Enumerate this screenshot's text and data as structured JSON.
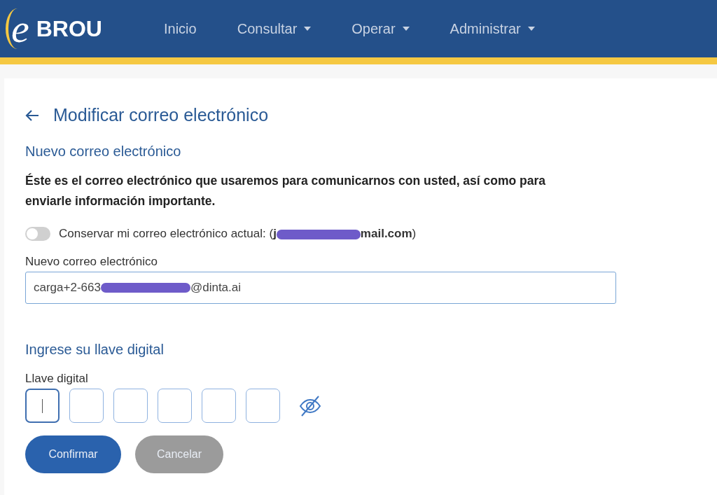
{
  "header": {
    "logo_letter": "e",
    "logo_text": "BROU",
    "nav": [
      {
        "label": "Inicio",
        "dropdown": false
      },
      {
        "label": "Consultar",
        "dropdown": true
      },
      {
        "label": "Operar",
        "dropdown": true
      },
      {
        "label": "Administrar",
        "dropdown": true
      }
    ]
  },
  "page": {
    "title": "Modificar correo electrónico",
    "section": "Nuevo correo electrónico",
    "description": "Éste es el correo electrónico que usaremos para comunicarnos con usted, así como para enviarle información importante.",
    "keep_toggle": {
      "checked": false,
      "label_start": "Conservar mi correo electrónico actual: (**j**",
      "label_end": "**mail.com**)"
    },
    "email_field": {
      "label": "Nuevo correo electrónico",
      "value_start": "carga+2-663",
      "value_end": "@dinta.ai"
    },
    "key_section": "Ingrese su llave digital",
    "key_label": "Llave digital",
    "key_digits": [
      {
        "focused": true
      },
      {
        "focused": false
      },
      {
        "focused": false
      },
      {
        "focused": false
      },
      {
        "focused": false
      },
      {
        "focused": false
      }
    ],
    "key_visible": false,
    "buttons": [
      {
        "label": "Confirmar",
        "kind": "primary"
      },
      {
        "label": "Cancelar",
        "kind": "secondary"
      }
    ]
  }
}
